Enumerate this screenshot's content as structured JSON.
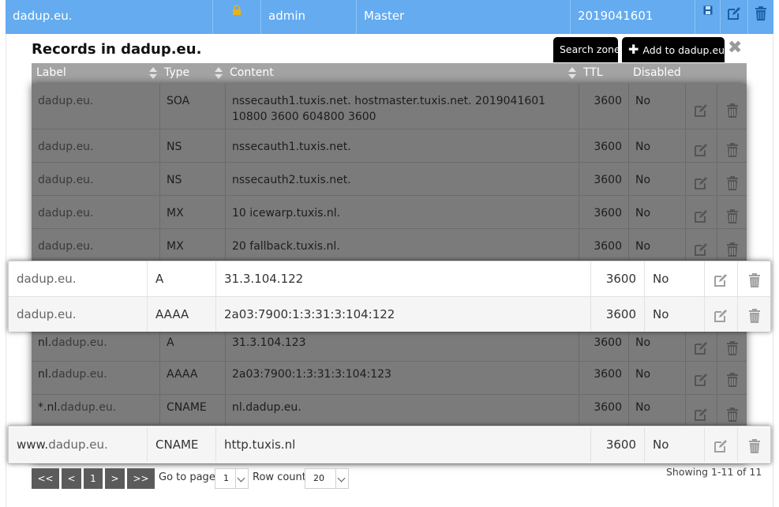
{
  "zone": {
    "name": "dadup.eu.",
    "lock_icon": "lock-icon",
    "owner": "admin",
    "kind": "Master",
    "serial": "2019041601"
  },
  "panel": {
    "title": "Records in dadup.eu.",
    "search_button": "Search zone",
    "add_button": "Add to dadup.eu.",
    "close_label": "✖"
  },
  "table": {
    "headers": {
      "label": "Label",
      "type": "Type",
      "content": "Content",
      "ttl": "TTL",
      "disabled": "Disabled"
    }
  },
  "records": [
    {
      "prefix": "",
      "zone": "dadup.eu.",
      "type": "SOA",
      "content": "nssecauth1.tuxis.net. hostmaster.tuxis.net. 2019041601 10800 3600 604800 3600",
      "ttl": "3600",
      "disabled": "No"
    },
    {
      "prefix": "",
      "zone": "dadup.eu.",
      "type": "NS",
      "content": "nssecauth1.tuxis.net.",
      "ttl": "3600",
      "disabled": "No"
    },
    {
      "prefix": "",
      "zone": "dadup.eu.",
      "type": "NS",
      "content": "nssecauth2.tuxis.net.",
      "ttl": "3600",
      "disabled": "No"
    },
    {
      "prefix": "",
      "zone": "dadup.eu.",
      "type": "MX",
      "content": "10 icewarp.tuxis.nl.",
      "ttl": "3600",
      "disabled": "No"
    },
    {
      "prefix": "",
      "zone": "dadup.eu.",
      "type": "MX",
      "content": "20 fallback.tuxis.nl.",
      "ttl": "3600",
      "disabled": "No"
    },
    {
      "prefix": "",
      "zone": "dadup.eu.",
      "type": "A",
      "content": "31.3.104.122",
      "ttl": "3600",
      "disabled": "No"
    },
    {
      "prefix": "",
      "zone": "dadup.eu.",
      "type": "AAAA",
      "content": "2a03:7900:1:3:31:3:104:122",
      "ttl": "3600",
      "disabled": "No"
    },
    {
      "prefix": "nl.",
      "zone": "dadup.eu.",
      "type": "A",
      "content": "31.3.104.123",
      "ttl": "3600",
      "disabled": "No"
    },
    {
      "prefix": "nl.",
      "zone": "dadup.eu.",
      "type": "AAAA",
      "content": "2a03:7900:1:3:31:3:104:123",
      "ttl": "3600",
      "disabled": "No"
    },
    {
      "prefix": "*.nl.",
      "zone": "dadup.eu.",
      "type": "CNAME",
      "content": "nl.dadup.eu.",
      "ttl": "3600",
      "disabled": "No"
    },
    {
      "prefix": "www.",
      "zone": "dadup.eu.",
      "type": "CNAME",
      "content": "http.tuxis.nl",
      "ttl": "3600",
      "disabled": "No"
    }
  ],
  "pager": {
    "first": "<<",
    "prev": "<",
    "current": "1",
    "next": ">",
    "last": ">>",
    "goto_label": "Go to page:",
    "goto_value": "1",
    "rowcount_label": "Row count:",
    "rowcount_value": "20",
    "showing": "Showing 1-11 of 11"
  },
  "colors": {
    "header_blue": "#64abf0",
    "dim_overlay": "#7b7b7b",
    "table_header": "#a3a3a3"
  }
}
